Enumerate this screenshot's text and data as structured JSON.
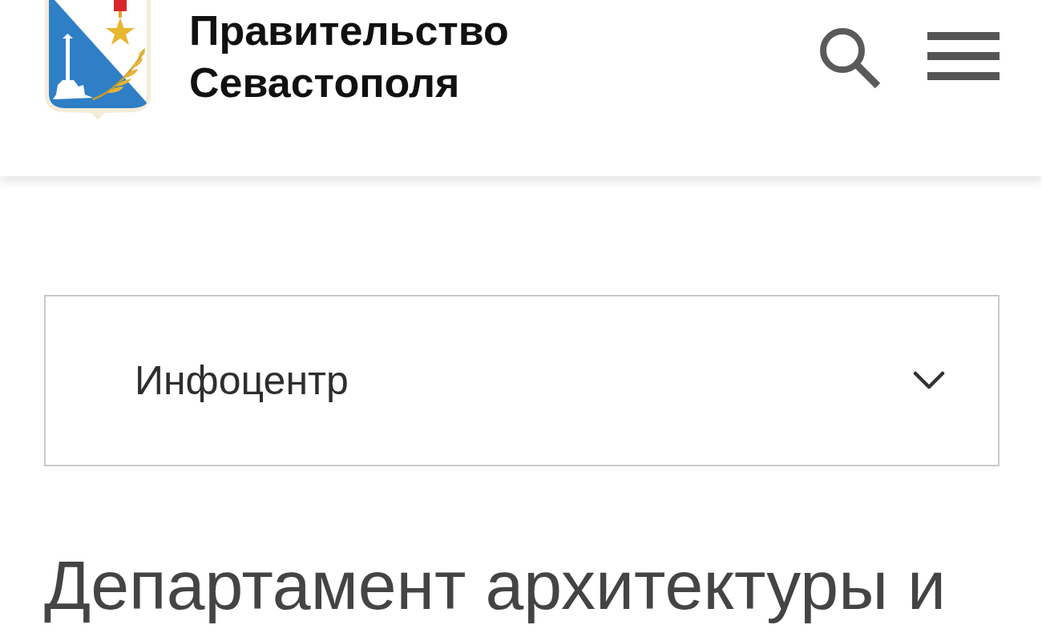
{
  "header": {
    "title": "Правительство Севастополя"
  },
  "section_select": {
    "value": "Инфоцентр",
    "expanded": false
  },
  "heading": "Департамент архитектуры и"
}
